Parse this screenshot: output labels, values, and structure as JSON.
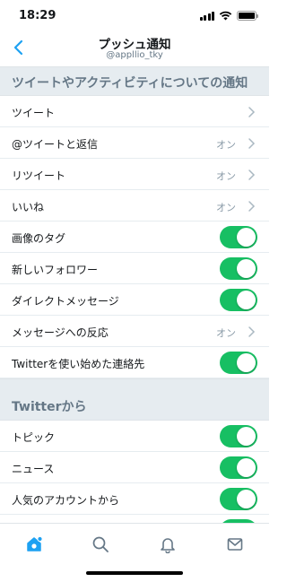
{
  "status_bar": {
    "time": "18:29"
  },
  "header": {
    "title": "プッシュ通知",
    "subtitle": "@appllio_tky"
  },
  "sections": [
    {
      "title": "ツイートやアクティビティについての通知",
      "items": [
        {
          "label": "ツイート",
          "control": "chevron"
        },
        {
          "label": "@ツイートと返信",
          "value": "オン",
          "control": "chevron"
        },
        {
          "label": "リツイート",
          "value": "オン",
          "control": "chevron"
        },
        {
          "label": "いいね",
          "value": "オン",
          "control": "chevron"
        },
        {
          "label": "画像のタグ",
          "control": "toggle",
          "on": true
        },
        {
          "label": "新しいフォロワー",
          "control": "toggle",
          "on": true
        },
        {
          "label": "ダイレクトメッセージ",
          "control": "toggle",
          "on": true
        },
        {
          "label": "メッセージへの反応",
          "value": "オン",
          "control": "chevron"
        },
        {
          "label": "Twitterを使い始めた連絡先",
          "control": "toggle",
          "on": true
        }
      ]
    },
    {
      "title": "Twitterから",
      "items": [
        {
          "label": "トピック",
          "control": "toggle",
          "on": true
        },
        {
          "label": "ニュース",
          "control": "toggle",
          "on": true
        },
        {
          "label": "人気のアカウントから",
          "control": "toggle",
          "on": true
        }
      ]
    }
  ],
  "tab_bar": {
    "tabs": [
      {
        "icon": "home-icon",
        "active": true
      },
      {
        "icon": "search-icon",
        "active": false
      },
      {
        "icon": "bell-icon",
        "active": false
      },
      {
        "icon": "mail-icon",
        "active": false
      }
    ]
  },
  "colors": {
    "accent": "#1da1f2",
    "toggle_on": "#17bf63",
    "section_bg": "#e6ecf0"
  }
}
